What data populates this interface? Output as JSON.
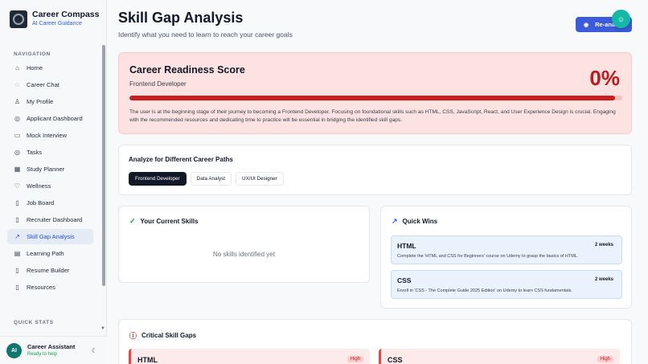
{
  "app": {
    "title": "Career Compass",
    "subtitle": "AI Career Guidance"
  },
  "sidebar": {
    "nav_heading": "NAVIGATION",
    "items": [
      {
        "label": "Home",
        "icon": "home-icon"
      },
      {
        "label": "Career Chat",
        "icon": "chat-icon"
      },
      {
        "label": "My Profile",
        "icon": "user-icon"
      },
      {
        "label": "Applicant Dashboard",
        "icon": "target-icon"
      },
      {
        "label": "Mock Interview",
        "icon": "video-icon"
      },
      {
        "label": "Tasks",
        "icon": "target-icon"
      },
      {
        "label": "Study Planner",
        "icon": "calendar-icon"
      },
      {
        "label": "Wellness",
        "icon": "heart-icon"
      },
      {
        "label": "Job Board",
        "icon": "file-icon"
      },
      {
        "label": "Recruiter Dashboard",
        "icon": "file-icon"
      },
      {
        "label": "Skill Gap Analysis",
        "icon": "trending-up-icon",
        "active": true
      },
      {
        "label": "Learning Path",
        "icon": "book-icon"
      },
      {
        "label": "Resume Builder",
        "icon": "file-icon"
      },
      {
        "label": "Resources",
        "icon": "file-icon"
      }
    ],
    "quick_stats_heading": "QUICK STATS",
    "assistant": {
      "initials": "AI",
      "name": "Career Assistant",
      "status": "Ready to help"
    }
  },
  "header": {
    "title": "Skill Gap Analysis",
    "subtitle": "Identify what you need to learn to reach your career goals",
    "reanalyze_label": "Re-ana"
  },
  "readiness": {
    "title": "Career Readiness Score",
    "role": "Frontend Developer",
    "score_text": "0%",
    "progress": 0.985,
    "description": "The user is at the beginning stage of their journey to becoming a Frontend Developer. Focusing on foundational skills such as HTML, CSS, JavaScript, React, and User Experience Design is crucial. Engaging with the recommended resources and dedicating time to practice will be essential in bridging the identified skill gaps."
  },
  "paths": {
    "title": "Analyze for Different Career Paths",
    "options": [
      "Frontend Developer",
      "Data Analyst",
      "UX/UI Designer"
    ],
    "selected": "Frontend Developer"
  },
  "skills": {
    "title": "Your Current Skills",
    "empty_text": "No skills identified yet"
  },
  "quick_wins": {
    "title": "Quick Wins",
    "items": [
      {
        "title": "HTML",
        "duration": "2 weeks",
        "description": "Complete the 'HTML and CSS for Beginners' course on Udemy to grasp the basics of HTML."
      },
      {
        "title": "CSS",
        "duration": "2 weeks",
        "description": "Enroll in 'CSS - The Complete Guide 2025 Edition' on Udemy to learn CSS fundamentals."
      }
    ]
  },
  "gaps": {
    "title": "Critical Skill Gaps",
    "items": [
      {
        "title": "HTML",
        "priority": "High"
      },
      {
        "title": "CSS",
        "priority": "High"
      }
    ]
  },
  "colors": {
    "accent": "#3b5bdb",
    "danger": "#c81e1e",
    "teal": "#14b8a6"
  }
}
